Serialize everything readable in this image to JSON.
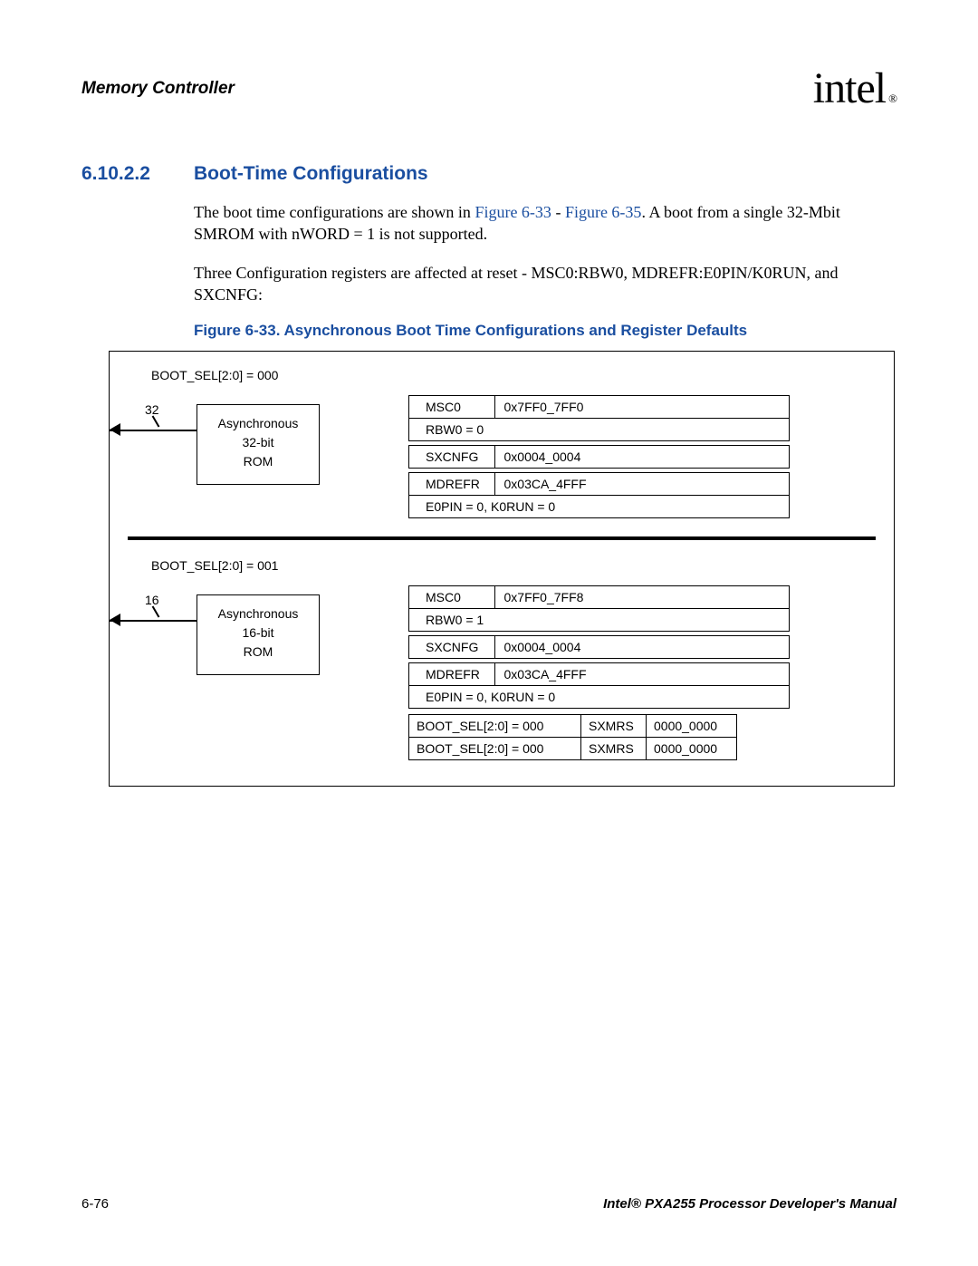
{
  "header": {
    "title": "Memory Controller",
    "logo_text": "intel",
    "logo_reg": "®"
  },
  "section": {
    "number": "6.10.2.2",
    "title": "Boot-Time Configurations"
  },
  "para1_a": "The boot time configurations are shown in ",
  "para1_link1": "Figure 6-33",
  "para1_b": " - ",
  "para1_link2": "Figure 6-35",
  "para1_c": ". A boot from a single 32-Mbit SMROM with nWORD = 1 is not supported.",
  "para2": "Three Configuration registers are affected at reset - MSC0:RBW0, MDREFR:E0PIN/K0RUN, and SXCNFG:",
  "figure_caption": "Figure 6-33. Asynchronous Boot Time Configurations and Register Defaults",
  "configs": [
    {
      "bootsel": "BOOT_SEL[2:0] = 000",
      "bus": "32",
      "rom_l1": "Asynchronous",
      "rom_l2": "32-bit",
      "rom_l3": "ROM",
      "regs": {
        "msc0": "MSC0",
        "msc0_val": "0x7FF0_7FF0",
        "rbw": "RBW0 = 0",
        "sxcnfg": "SXCNFG",
        "sxcnfg_val": "0x0004_0004",
        "mdrefr": "MDREFR",
        "mdrefr_val": "0x03CA_4FFF",
        "e0pin": "E0PIN = 0, K0RUN = 0"
      }
    },
    {
      "bootsel": "BOOT_SEL[2:0] = 001",
      "bus": "16",
      "rom_l1": "Asynchronous",
      "rom_l2": "16-bit",
      "rom_l3": "ROM",
      "regs": {
        "msc0": "MSC0",
        "msc0_val": "0x7FF0_7FF8",
        "rbw": "RBW0 = 1",
        "sxcnfg": "SXCNFG",
        "sxcnfg_val": "0x0004_0004",
        "mdrefr": "MDREFR",
        "mdrefr_val": "0x03CA_4FFF",
        "e0pin": "E0PIN = 0, K0RUN = 0"
      },
      "sxrows": [
        {
          "c1": "BOOT_SEL[2:0] = 000",
          "c2": "SXMRS",
          "c3": "0000_0000"
        },
        {
          "c1": "BOOT_SEL[2:0] = 000",
          "c2": "SXMRS",
          "c3": "0000_0000"
        }
      ]
    }
  ],
  "footer": {
    "page": "6-76",
    "manual": "Intel® PXA255 Processor Developer's Manual"
  }
}
